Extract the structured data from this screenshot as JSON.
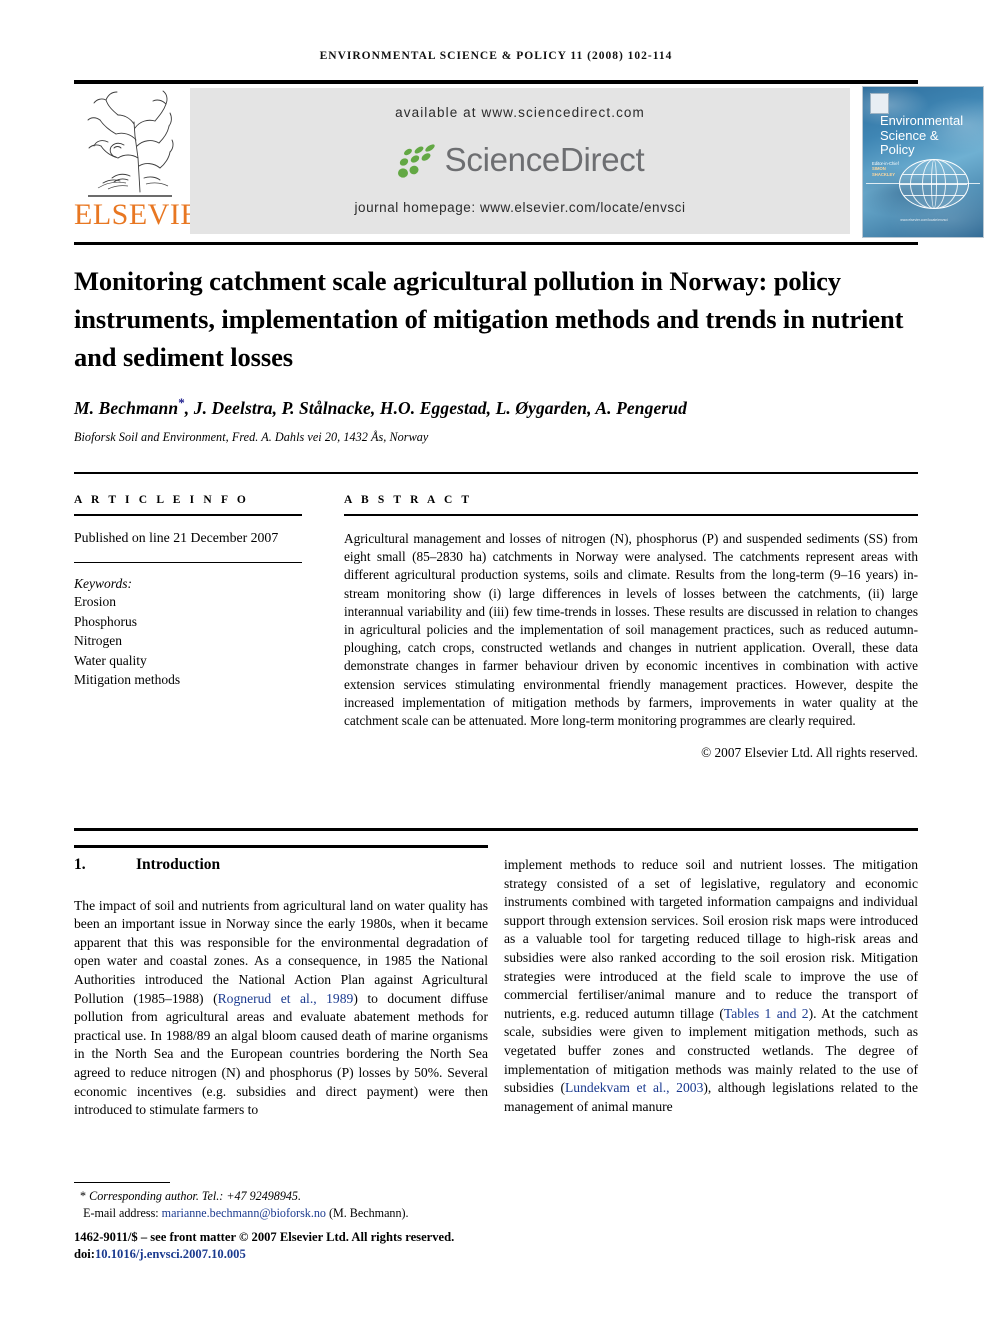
{
  "running_head": "ENVIRONMENTAL SCIENCE & POLICY 11 (2008) 102-114",
  "masthead": {
    "publisher_name": "ELSEVIER",
    "available_at": "available at www.sciencedirect.com",
    "sciencedirect_wordmark": "ScienceDirect",
    "journal_homepage": "journal homepage: www.elsevier.com/locate/envsci",
    "cover": {
      "title_line1": "Environmental",
      "title_line2": "Science &",
      "title_line3": "Policy",
      "editor_label": "Editor-in-Chief",
      "editor_name": "SIMON SHACKLEY",
      "footer_note": "www.elsevier.com/locate/envsci"
    }
  },
  "article": {
    "title": "Monitoring catchment scale agricultural pollution in Norway: policy instruments, implementation of mitigation methods and trends in nutrient and sediment losses",
    "authors": "M. Bechmann",
    "authors_rest": ", J. Deelstra, P. Stålnacke, H.O. Eggestad, L. Øygarden, A. Pengerud",
    "corresponding_marker": "*",
    "affiliation": "Bioforsk Soil and Environment, Fred. A. Dahls vei 20, 1432 Ås, Norway"
  },
  "article_info": {
    "heading": "A R T I C L E   I N F O",
    "published": "Published on line 21 December 2007",
    "keywords_label": "Keywords:",
    "keywords": [
      "Erosion",
      "Phosphorus",
      "Nitrogen",
      "Water quality",
      "Mitigation methods"
    ]
  },
  "abstract": {
    "heading": "A B S T R A C T",
    "text": "Agricultural management and losses of nitrogen (N), phosphorus (P) and suspended sediments (SS) from eight small (85–2830 ha) catchments in Norway were analysed. The catchments represent areas with different agricultural production systems, soils and climate. Results from the long-term (9–16 years) in-stream monitoring show (i) large differences in levels of losses between the catchments, (ii) large interannual variability and (iii) few time-trends in losses. These results are discussed in relation to changes in agricultural policies and the implementation of soil management practices, such as reduced autumn-ploughing, catch crops, constructed wetlands and changes in nutrient application. Overall, these data demonstrate changes in farmer behaviour driven by economic incentives in combination with active extension services stimulating environmental friendly management practices. However, despite the increased implementation of mitigation methods by farmers, improvements in water quality at the catchment scale can be attenuated. More long-term monitoring programmes are clearly required.",
    "copyright": "© 2007 Elsevier Ltd. All rights reserved."
  },
  "sections": {
    "intro_number": "1.",
    "intro_title": "Introduction",
    "left_col_part1": "The impact of soil and nutrients from agricultural land on water quality has been an important issue in Norway since the early 1980s, when it became apparent that this was responsible for the environmental degradation of open water and coastal zones. As a consequence, in 1985 the National Authorities introduced the National Action Plan against Agricultural Pollution (1985–1988) (",
    "left_ref1": "Rognerud et al., 1989",
    "left_col_part2": ") to document diffuse pollution from agricultural areas and evaluate abatement methods for practical use. In 1988/89 an algal bloom caused death of marine organisms in the North Sea and the European countries bordering the North Sea agreed to reduce nitrogen (N) and phosphorus (P) losses by 50%. Several economic incentives (e.g. subsidies and direct payment) were then introduced to stimulate farmers to",
    "right_col_part1": "implement methods to reduce soil and nutrient losses. The mitigation strategy consisted of a set of legislative, regulatory and economic instruments combined with targeted information campaigns and individual support through extension services. Soil erosion risk maps were introduced as a valuable tool for targeting reduced tillage to high-risk areas and subsidies were also ranked according to the soil erosion risk. Mitigation strategies were introduced at the field scale to improve the use of commercial fertiliser/animal manure and to reduce the transport of nutrients, e.g. reduced autumn tillage (",
    "right_ref1": "Tables 1 and 2",
    "right_col_part2": "). At the catchment scale, subsidies were given to implement mitigation methods, such as vegetated buffer zones and constructed wetlands. The degree of implementation of mitigation methods was mainly related to the use of subsidies (",
    "right_ref2": "Lundekvam et al., 2003",
    "right_col_part3": "), although legislations related to the management of animal manure"
  },
  "footnote": {
    "marker": "*",
    "corresponding": "Corresponding author. Tel.: +47 92498945.",
    "email_label": "E-mail address:",
    "email": "marianne.bechmann@bioforsk.no",
    "email_suffix": "(M. Bechmann).",
    "issn_line": "1462-9011/$ – see front matter © 2007 Elsevier Ltd. All rights reserved.",
    "doi_label": "doi:",
    "doi": "10.1016/j.envsci.2007.10.005"
  },
  "colors": {
    "elsevier_orange": "#E87722",
    "sciencedirect_green": "#63A844",
    "sciencedirect_gray": "#6d6e71",
    "link_blue": "#1a3a8f",
    "banner_gray": "#e4e4e4"
  }
}
